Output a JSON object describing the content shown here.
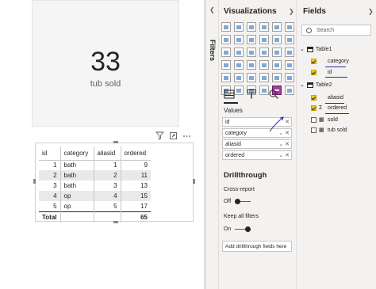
{
  "card": {
    "value": "33",
    "label": "tub sold"
  },
  "table": {
    "columns": [
      "id",
      "category",
      "aliasid",
      "ordered"
    ],
    "rows": [
      [
        "1",
        "bath",
        "1",
        "9"
      ],
      [
        "2",
        "bath",
        "2",
        "11"
      ],
      [
        "3",
        "bath",
        "3",
        "13"
      ],
      [
        "4",
        "op",
        "4",
        "15"
      ],
      [
        "5",
        "op",
        "5",
        "17"
      ]
    ],
    "total_label": "Total",
    "total_value": "65"
  },
  "filters": {
    "label": "Filters"
  },
  "visualizations": {
    "title": "Visualizations",
    "values_label": "Values",
    "wells": [
      "id",
      "category",
      "aliasid",
      "ordered"
    ],
    "drillthrough": {
      "title": "Drillthrough",
      "cross_report_label": "Cross-report",
      "cross_report_state": "Off",
      "keep_filters_label": "Keep all filters",
      "keep_filters_state": "On",
      "add_fields_placeholder": "Add drillthrough fields here"
    }
  },
  "fields": {
    "title": "Fields",
    "search_placeholder": "Search",
    "table1": {
      "name": "Table1",
      "fields": [
        "category",
        "id"
      ]
    },
    "table2": {
      "name": "Table2",
      "fields": [
        "aliasid",
        "ordered",
        "sold",
        "tub sold"
      ]
    }
  },
  "colors": {
    "checkbox_on": "#f2c811",
    "selected_visual": "#a33b9a",
    "ink": "#1a2fa8"
  }
}
